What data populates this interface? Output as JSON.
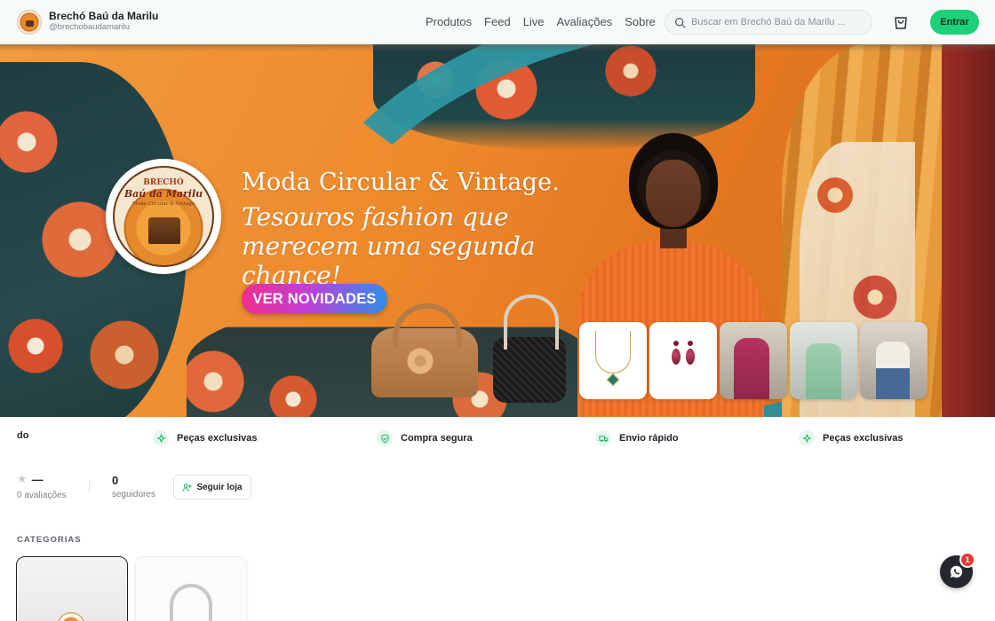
{
  "brand": {
    "name": "Brechó Baú da Marilu",
    "handle": "@brechobaudamarilu",
    "logo_icon": "brand-logo-icon"
  },
  "nav": {
    "items": [
      {
        "label": "Produtos"
      },
      {
        "label": "Feed"
      },
      {
        "label": "Live"
      },
      {
        "label": "Avaliações"
      },
      {
        "label": "Sobre"
      }
    ]
  },
  "search": {
    "placeholder": "Buscar em Brechó Baú da Marilu ...",
    "icon": "search-icon"
  },
  "header": {
    "cart_icon": "cart-icon",
    "login_label": "Entrar",
    "login_color": "#1ed07a"
  },
  "banner": {
    "headline": "Moda Circular & Vintage.",
    "subheadline": "Tesouros fashion que merecem uma segunda chance!",
    "cta_label": "VER NOVIDADES",
    "logo_text_top": "BRECHÓ",
    "logo_text_main": "Baú da Marilu",
    "logo_text_sub": "Moda Circular & Vintage"
  },
  "features": {
    "items": [
      {
        "label": "do",
        "icon": ""
      },
      {
        "label": "Peças exclusivas",
        "icon": "sparkles-icon"
      },
      {
        "label": "Compra segura",
        "icon": "shield-check-icon"
      },
      {
        "label": "Envio rápido",
        "icon": "truck-icon"
      },
      {
        "label": "Peças exclusivas",
        "icon": "sparkles-icon"
      }
    ]
  },
  "stats": {
    "rating_value": "—",
    "rating_label": "0 avaliações",
    "followers_value": "0",
    "followers_label": "seguidores",
    "follow_label": "Seguir loja"
  },
  "categories": {
    "title": "CATEGORIAS"
  },
  "chat": {
    "icon": "whatsapp-icon",
    "badge_count": "1"
  }
}
